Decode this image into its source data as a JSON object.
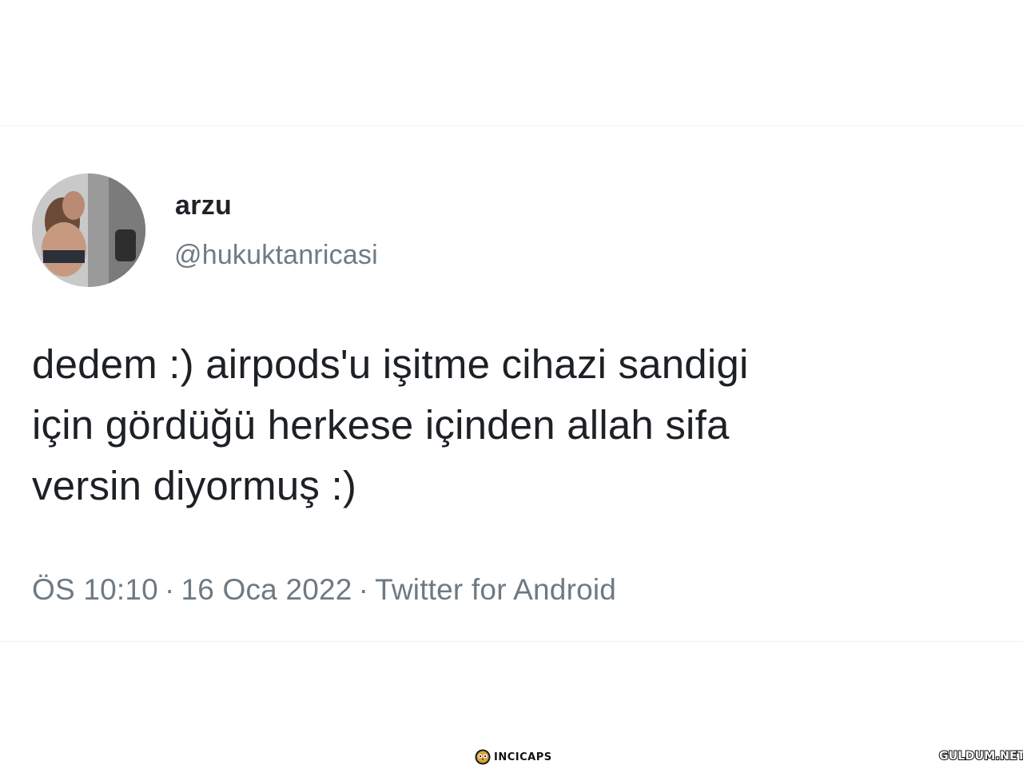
{
  "tweet": {
    "display_name": "arzu",
    "handle": "@hukuktanricasi",
    "text_lines": [
      "dedem :) airpods'u işitme cihazi sandigi",
      "için gördüğü herkese içinden allah sifa",
      "versin diyormuş :)"
    ],
    "time": "ÖS 10:10",
    "date": "16 Oca 2022",
    "source": "Twitter for Android",
    "separator": "·"
  },
  "watermarks": {
    "left": "INCICAPS",
    "right": "GULDUM.NET"
  },
  "colors": {
    "name": "#1f2328",
    "secondary_text": "#6e7a83",
    "body_text": "#1d2125",
    "background": "#ffffff"
  },
  "icons": {
    "watermark_left_icon": "owl-icon"
  }
}
